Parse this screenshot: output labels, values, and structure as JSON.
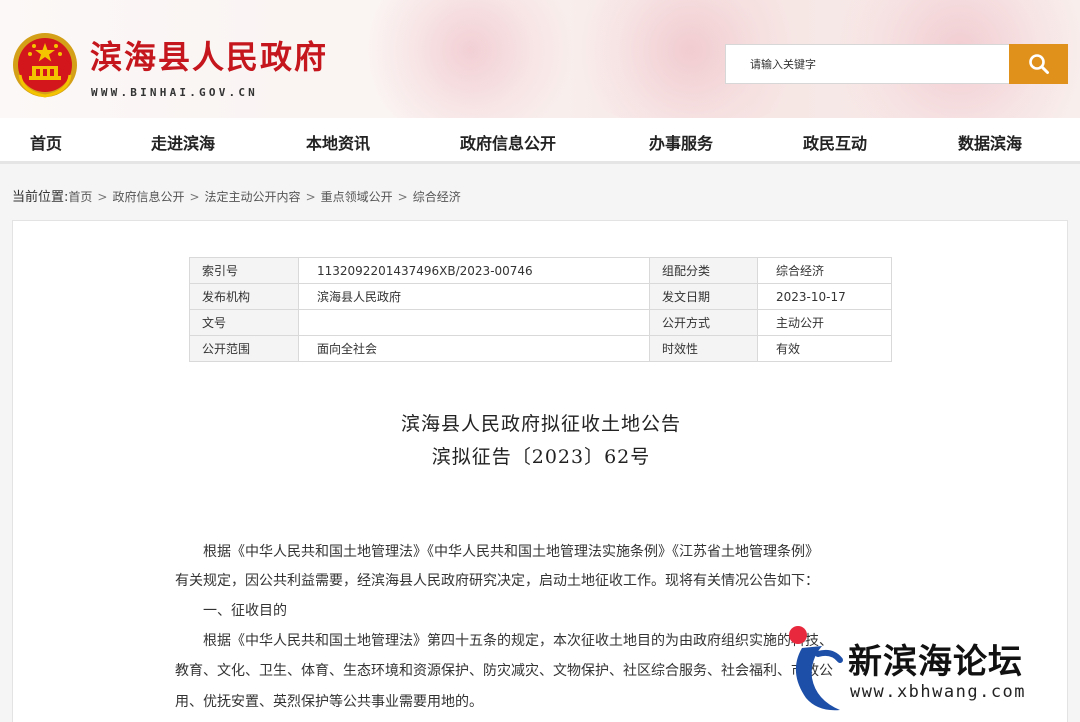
{
  "header": {
    "site_title": "滨海县人民政府",
    "site_url": "WWW.BINHAI.GOV.CN",
    "search": {
      "placeholder": "请输入关键字",
      "value": ""
    },
    "colors": {
      "brand": "#c4161c",
      "accent": "#e0911b"
    }
  },
  "nav": {
    "items": [
      {
        "label": "首页"
      },
      {
        "label": "走进滨海"
      },
      {
        "label": "本地资讯"
      },
      {
        "label": "政府信息公开"
      },
      {
        "label": "办事服务"
      },
      {
        "label": "政民互动"
      },
      {
        "label": "数据滨海"
      }
    ]
  },
  "breadcrumb": {
    "lead": "当前位置:",
    "items": [
      "首页",
      "政府信息公开",
      "法定主动公开内容",
      "重点领域公开",
      "综合经济"
    ],
    "separator": ">"
  },
  "meta_table": {
    "rows": [
      {
        "k1": "索引号",
        "v1": "1132092201437496XB/2023-00746",
        "k2": "组配分类",
        "v2": "综合经济"
      },
      {
        "k1": "发布机构",
        "v1": "滨海县人民政府",
        "k2": "发文日期",
        "v2": "2023-10-17"
      },
      {
        "k1": "文号",
        "v1": "",
        "k2": "公开方式",
        "v2": "主动公开"
      },
      {
        "k1": "公开范围",
        "v1": "面向全社会",
        "k2": "时效性",
        "v2": "有效"
      }
    ]
  },
  "document": {
    "title": "滨海县人民政府拟征收土地公告",
    "subtitle": "滨拟征告〔2023〕62号",
    "lines": [
      "　　根据《中华人民共和国土地管理法》《中华人民共和国土地管理法实施条例》《江苏省土地管理条例》",
      "有关规定，因公共利益需要，经滨海县人民政府研究决定，启动土地征收工作。现将有关情况公告如下：",
      "　　一、征收目的",
      "　　根据《中华人民共和国土地管理法》第四十五条的规定，本次征收土地目的为由政府组织实施的科技、",
      "教育、文化、卫生、体育、生态环境和资源保护、防灾减灾、文物保护、社区综合服务、社会福利、市政公",
      "用、优抚安置、英烈保护等公共事业需要用地的。"
    ]
  },
  "watermark": {
    "name": "新滨海论坛",
    "url": "www.xbhwang.com",
    "colors": {
      "red": "#e8283c",
      "blue": "#1d4fa8"
    }
  }
}
